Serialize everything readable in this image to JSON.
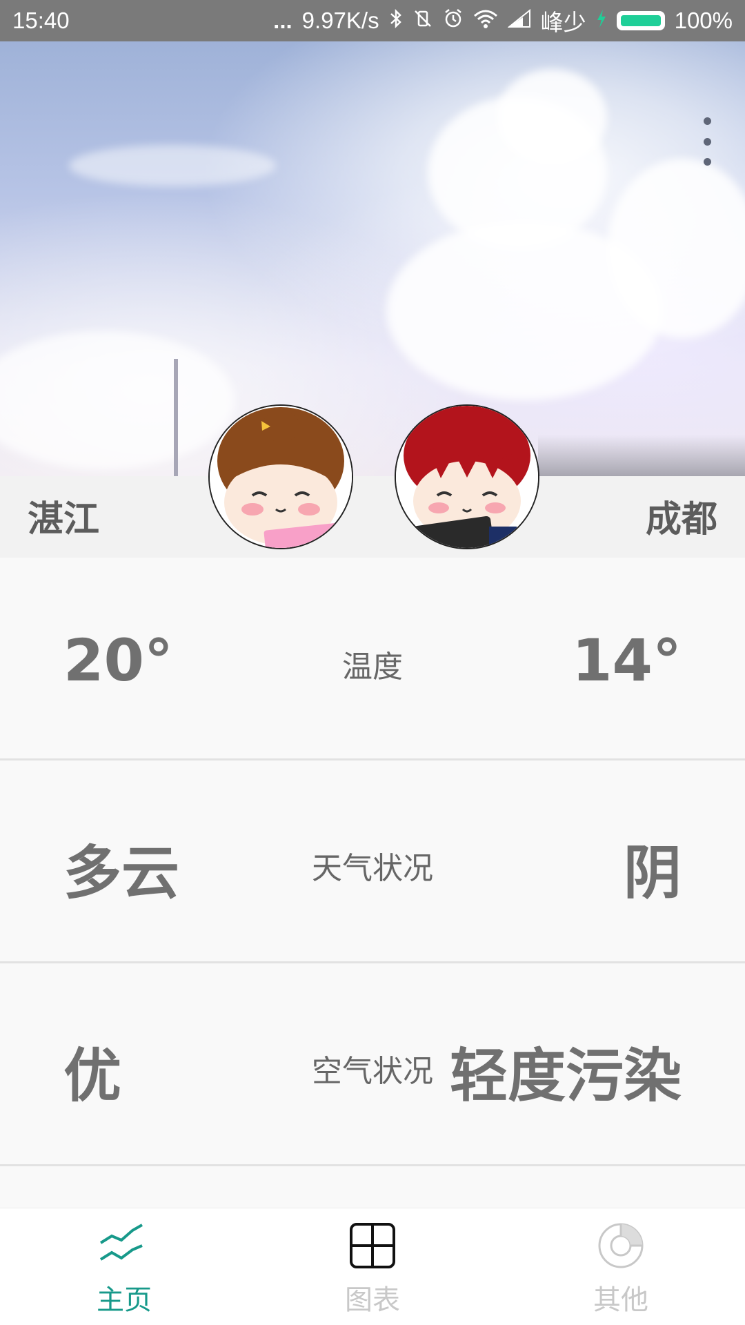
{
  "status_bar": {
    "time": "15:40",
    "dots": "...",
    "net_speed": "9.97K/s",
    "bluetooth_icon": "bluetooth-icon",
    "silent_icon": "vibrate-off-icon",
    "alarm_icon": "alarm-icon",
    "wifi_icon": "wifi-icon",
    "signal_icon": "signal-icon",
    "carrier": "峰少",
    "charging_icon": "charging-bolt-icon",
    "battery": "100%",
    "colors": {
      "bar": "#7a7a7a",
      "battery_fill": "#1fcf98"
    }
  },
  "header": {
    "more_icon": "more-vertical-icon"
  },
  "cities": {
    "left": "湛江",
    "right": "成都",
    "left_avatar": "girl-avatar",
    "right_avatar": "boy-avatar"
  },
  "rows": [
    {
      "left": "20°",
      "label": "温度",
      "right": "14°"
    },
    {
      "left": "多云",
      "label": "天气状况",
      "right": "阴"
    },
    {
      "left": "优",
      "label": "空气状况",
      "right": "轻度污染"
    }
  ],
  "nav": {
    "active_color": "#17998a",
    "inactive_color": "#c8c8c8",
    "items": [
      {
        "label": "主页",
        "icon": "trend-lines-icon",
        "active": true
      },
      {
        "label": "图表",
        "icon": "grid-icon",
        "active": false
      },
      {
        "label": "其他",
        "icon": "pie-chart-icon",
        "active": false
      }
    ]
  }
}
